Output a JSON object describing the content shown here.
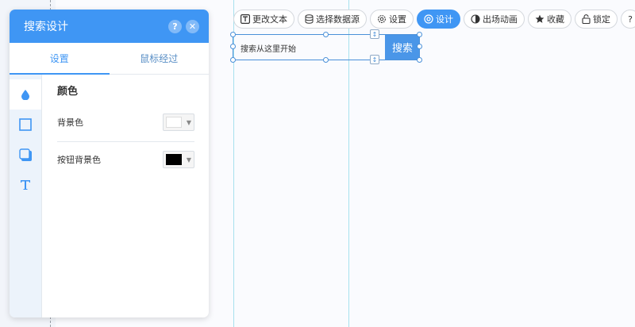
{
  "panel": {
    "title": "搜索设计",
    "help_icon": "?",
    "close_icon": "✕",
    "tabs": [
      {
        "label": "设置",
        "active": true
      },
      {
        "label": "鼠标经过",
        "active": false
      }
    ],
    "side_icons": [
      "drop-icon",
      "square-outline-icon",
      "shadow-box-icon",
      "text-icon"
    ],
    "section_title": "颜色",
    "rows": [
      {
        "label": "背景色",
        "swatch_color": "#ffffff"
      },
      {
        "label": "按钮背景色",
        "swatch_color": "#000000"
      }
    ]
  },
  "toolbar": {
    "items": [
      {
        "label": "更改文本",
        "icon": "text-box-icon"
      },
      {
        "label": "选择数据源",
        "icon": "database-icon"
      },
      {
        "label": "设置",
        "icon": "gear-icon"
      },
      {
        "label": "设计",
        "icon": "palette-icon",
        "active": true
      },
      {
        "label": "出场动画",
        "icon": "animation-icon"
      },
      {
        "label": "收藏",
        "icon": "star-icon"
      },
      {
        "label": "锁定",
        "icon": "lock-icon"
      }
    ],
    "help_label": "?"
  },
  "search_widget": {
    "placeholder_text": "搜索从这里开始",
    "button_label": "搜索"
  },
  "colors": {
    "accent": "#3f96f4",
    "search_button": "#4a96e8"
  }
}
